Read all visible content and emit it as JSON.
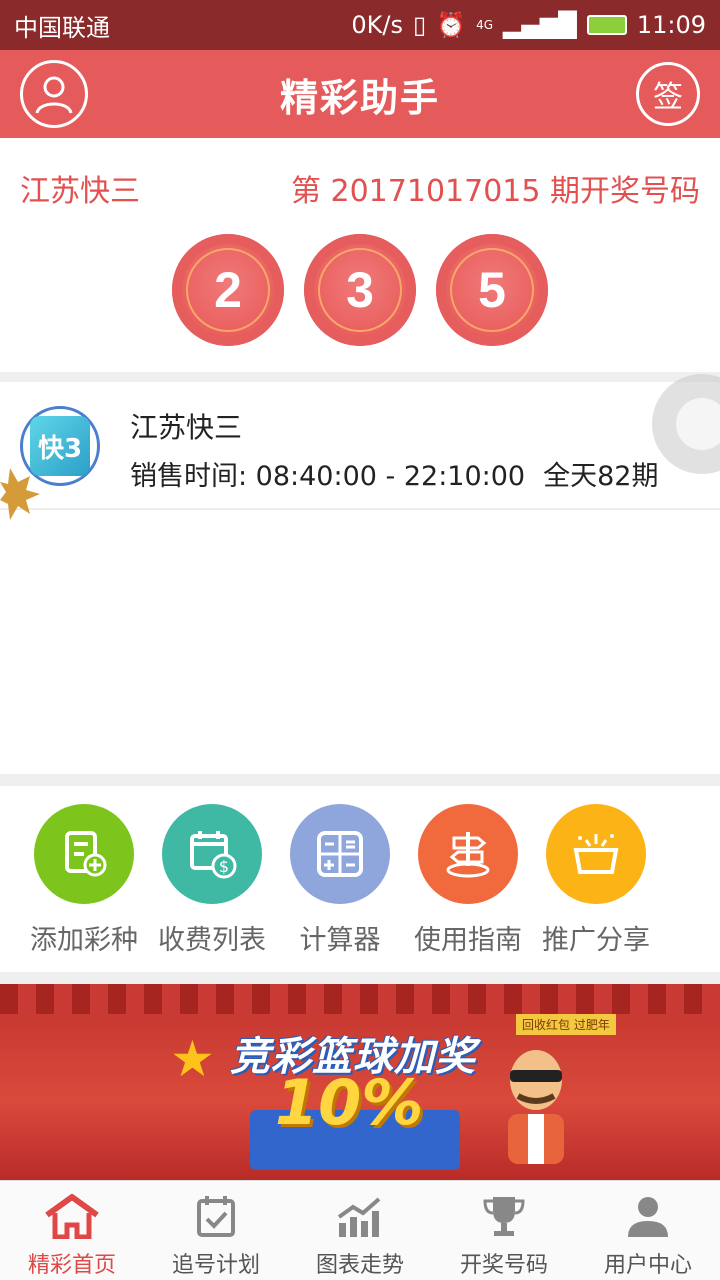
{
  "status_bar": {
    "carrier": "中国联通",
    "speed": "0K/s",
    "network": "4G",
    "time": "11:09"
  },
  "app_bar": {
    "title": "精彩助手",
    "sign_label": "签"
  },
  "draw": {
    "lottery_name": "江苏快三",
    "issue_text": "第 20171017015 期开奖号码",
    "numbers": [
      "2",
      "3",
      "5"
    ]
  },
  "lottery_list": [
    {
      "name": "江苏快三",
      "logo_text": "快3",
      "sale_time": "销售时间: 08:40:00 - 22:10:00",
      "total_issues": "全天82期"
    }
  ],
  "menu": [
    {
      "label": "添加彩种",
      "icon": "add-lottery-icon",
      "color": "#7dc51d"
    },
    {
      "label": "收费列表",
      "icon": "fee-list-icon",
      "color": "#3fb8a4"
    },
    {
      "label": "计算器",
      "icon": "calculator-icon",
      "color": "#8fa6dd"
    },
    {
      "label": "使用指南",
      "icon": "guide-icon",
      "color": "#f06a3e"
    },
    {
      "label": "推广分享",
      "icon": "share-icon",
      "color": "#fbb315"
    }
  ],
  "banner": {
    "headline": "竞彩篮球加奖",
    "percent": "10%",
    "tag": "回收红包 过肥年"
  },
  "tabs": [
    {
      "label": "精彩首页",
      "icon": "home-icon",
      "active": true
    },
    {
      "label": "追号计划",
      "icon": "calendar-check-icon",
      "active": false
    },
    {
      "label": "图表走势",
      "icon": "trend-chart-icon",
      "active": false
    },
    {
      "label": "开奖号码",
      "icon": "trophy-icon",
      "active": false
    },
    {
      "label": "用户中心",
      "icon": "user-icon",
      "active": false
    }
  ],
  "colors": {
    "primary": "#e55a5a",
    "status_bar": "#8a2a2a",
    "accent_text": "#e25050"
  }
}
